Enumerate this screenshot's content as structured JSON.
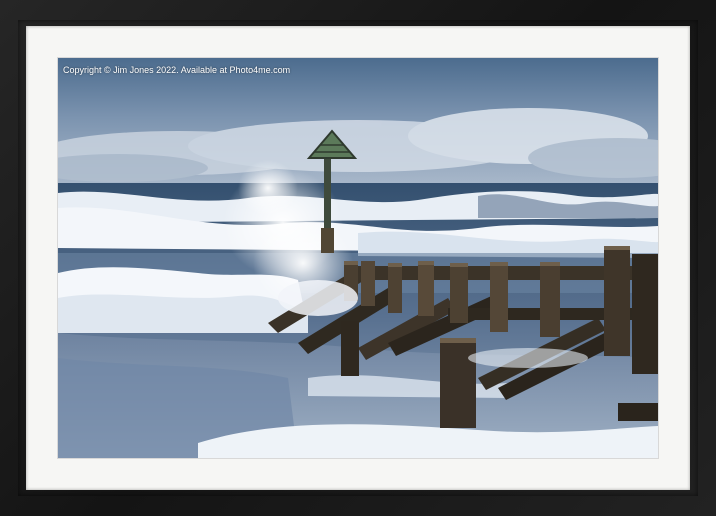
{
  "watermark": {
    "copyright": "Copyright © Jim Jones 2022. Available at Photo4me.com"
  },
  "colors": {
    "frame": "#1e1e1e",
    "mount": "#f6f6f4",
    "sky_top": "#4f6f90",
    "sky_mid": "#8ca2bb",
    "sea": "#3d5878",
    "foam": "#eef2f7",
    "wood": "#3b3328"
  }
}
